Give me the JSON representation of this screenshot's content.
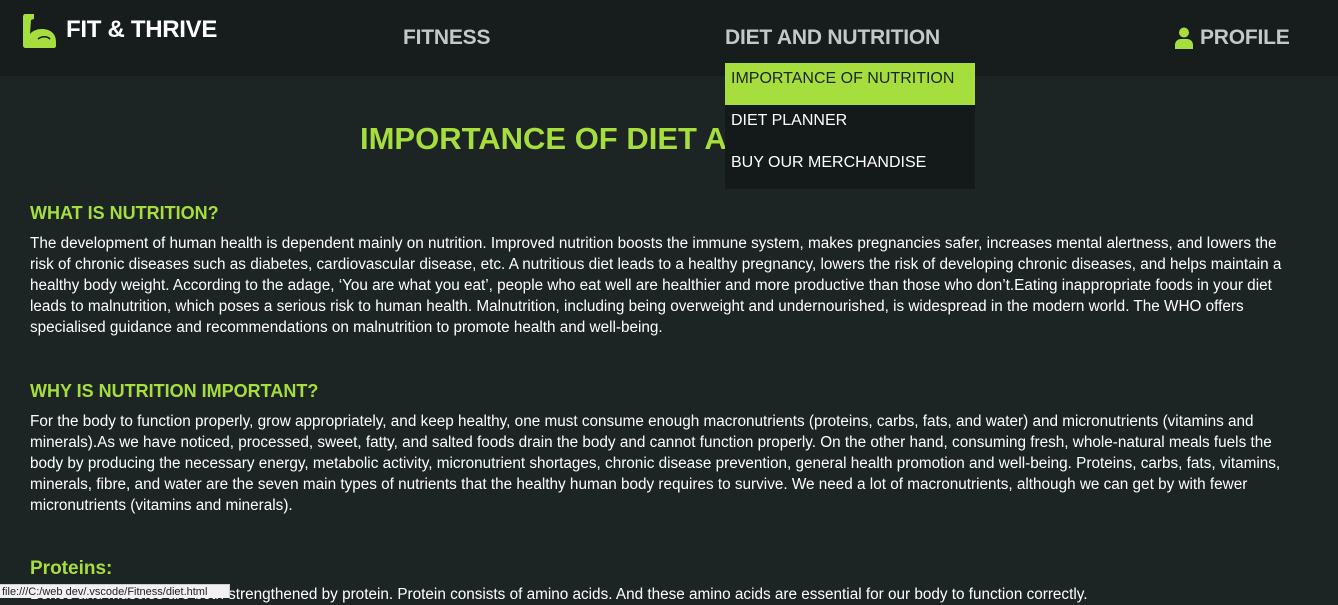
{
  "brand": {
    "name": "FIT & THRIVE",
    "logo_icon": "flexed-arm-icon"
  },
  "nav": {
    "fitness": "FITNESS",
    "diet": "DIET AND NUTRITION",
    "profile": "PROFILE",
    "profile_icon": "user-icon"
  },
  "dropdown": {
    "items": [
      {
        "label": "IMPORTANCE OF NUTRITION",
        "active": true
      },
      {
        "label": "DIET PLANNER",
        "active": false
      },
      {
        "label": "BUY OUR MERCHANDISE",
        "active": false
      }
    ]
  },
  "page": {
    "title_visible": "IMPORTANCE OF DIET A"
  },
  "sections": [
    {
      "heading": "WHAT IS NUTRITION?",
      "text": "The development of human health is dependent mainly on nutrition. Improved nutrition boosts the immune system, makes pregnancies safer, increases mental alertness, and lowers the risk of chronic diseases such as diabetes, cardiovascular disease, etc. A nutritious diet leads to a healthy pregnancy, lowers the risk of developing chronic diseases, and helps maintain a healthy body weight. According to the adage, ‘You are what you eat’, people who eat well are healthier and more productive than those who don’t.Eating inappropriate foods in your diet leads to malnutrition, which poses a serious risk to human health. Malnutrition, including being overweight and undernourished, is widespread in the modern world. The WHO offers specialised guidance and recommendations on malnutrition to promote health and well-being."
    },
    {
      "heading": "WHY IS NUTRITION IMPORTANT?",
      "text": "For the body to function properly, grow appropriately, and keep healthy, one must consume enough macronutrients (proteins, carbs, fats, and water) and micronutrients (vitamins and minerals).As we have noticed, processed, sweet, fatty, and salted foods drain the body and cannot function properly. On the other hand, consuming fresh, whole-natural meals fuels the body by producing the necessary energy, metabolic activity, micronutrient shortages, chronic disease prevention, general health promotion and well-being. Proteins, carbs, fats, vitamins, minerals, fibre, and water are the seven main types of nutrients that the healthy human body requires to survive. We need a lot of macronutrients, although we can get by with fewer micronutrients (vitamins and minerals)."
    },
    {
      "heading": "Proteins:",
      "text": "Bones and muscles are both strengthened by protein. Protein consists of amino acids. And these amino acids are essential for our body to function correctly."
    }
  ],
  "status_bar": {
    "url": "file:///C:/web dev/.vscode/Fitness/diet.html"
  },
  "colors": {
    "accent": "#a6de3d",
    "background": "#1d2424",
    "navbar": "#171c1c",
    "dropdown": "#141919"
  }
}
